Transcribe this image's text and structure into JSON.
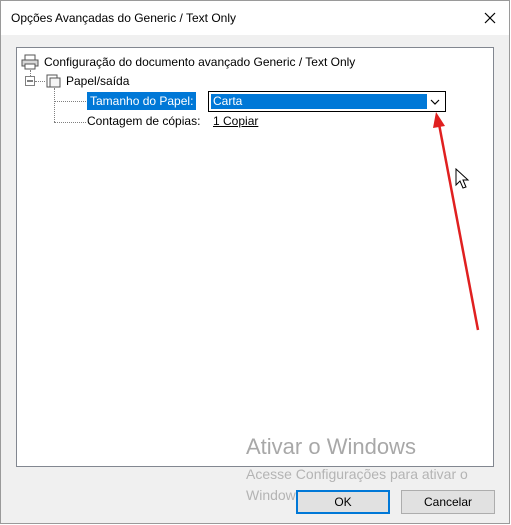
{
  "dialog": {
    "title": "Opções Avançadas do Generic / Text Only",
    "close_icon": "close-icon"
  },
  "tree": {
    "root_label": "Configuração do documento avançado Generic / Text Only",
    "root_icon": "printer-icon",
    "section_label": "Papel/saída",
    "section_icon": "paper-icon",
    "paper_size": {
      "label": "Tamanho do Papel:",
      "value": "Carta"
    },
    "copies": {
      "label": "Contagem de cópias:",
      "value": "1 Copiar"
    }
  },
  "buttons": {
    "ok": "OK",
    "cancel": "Cancelar"
  },
  "watermark": {
    "title": "Ativar o Windows",
    "subtitle": "Acesse Configurações para ativar o Windows."
  },
  "colors": {
    "selection": "#0078d7",
    "annotation_arrow": "#e02020"
  }
}
